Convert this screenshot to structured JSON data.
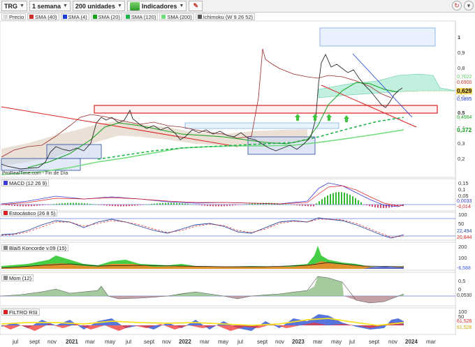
{
  "toolbar": {
    "symbol": "TRG",
    "period": "1 semana",
    "units": "200 unidades",
    "indicators": "Indicadores",
    "icon_refresh": "refresh-icon",
    "icon_settings": "settings-icon"
  },
  "legend": [
    {
      "label": "Precio",
      "color": "#d9d9d9"
    },
    {
      "label": "SMA (40)",
      "color": "#d12d2d"
    },
    {
      "label": "SMA (4)",
      "color": "#1b3bd6"
    },
    {
      "label": "SMA (20)",
      "color": "#15a11e"
    },
    {
      "label": "SMA (120)",
      "color": "#1db44b"
    },
    {
      "label": "SMA (200)",
      "color": "#6ddc7a"
    },
    {
      "label": "Ichimoku (W 9 26 52)",
      "color": "#555555"
    }
  ],
  "watermark": "ProRealTime.com - Fin de Día",
  "price_axis": [
    "1",
    "0,9",
    "0,8",
    "0,7",
    "0,6",
    "0,5",
    "0,4",
    "0,3",
    "0,2"
  ],
  "price_tags": [
    {
      "text": "0,7022",
      "bg": "#ffffff",
      "fg": "#5ec85e"
    },
    {
      "text": "0,6900",
      "bg": "#ffffff",
      "fg": "#c0392b"
    },
    {
      "text": "0,629",
      "bg": "#f6d65a",
      "fg": "#111111"
    },
    {
      "text": "0,5895",
      "bg": "#ffffff",
      "fg": "#1b3bd6"
    },
    {
      "text": "0,4564",
      "bg": "#ffffff",
      "fg": "#15a11e"
    },
    {
      "text": "0,372",
      "bg": "#ffffff",
      "fg": "#15a11e"
    }
  ],
  "panels": {
    "macd": {
      "label": "MACD (12 26 9)",
      "axis": [
        "0,15",
        "0,1",
        "0,05"
      ],
      "tags": [
        "0,0033",
        "-0,014"
      ]
    },
    "stoch": {
      "label": "Estocástico (26 8 5)",
      "axis": [
        "100",
        "50"
      ],
      "tags": [
        "22,494",
        "20,844"
      ]
    },
    "blai": {
      "label": "Blai5 Koncorde v.09 (15)",
      "axis": [
        "200",
        "100"
      ],
      "tags": [
        "-6,588"
      ]
    },
    "mom": {
      "label": "Mom (12)",
      "axis": [
        "0,5",
        "0"
      ],
      "tags": [
        "0,0530"
      ]
    },
    "rsi": {
      "label": "FILTRO RSI",
      "axis": [
        "100",
        "50"
      ],
      "tags": [
        "61,526",
        "61,526"
      ]
    }
  },
  "x_axis": [
    {
      "text": "jul",
      "bold": false
    },
    {
      "text": "sept",
      "bold": false
    },
    {
      "text": "nov",
      "bold": false
    },
    {
      "text": "2021",
      "bold": true
    },
    {
      "text": "mar",
      "bold": false
    },
    {
      "text": "may",
      "bold": false
    },
    {
      "text": "jul",
      "bold": false
    },
    {
      "text": "sept",
      "bold": false
    },
    {
      "text": "nov",
      "bold": false
    },
    {
      "text": "2022",
      "bold": true
    },
    {
      "text": "mar",
      "bold": false
    },
    {
      "text": "may",
      "bold": false
    },
    {
      "text": "jul",
      "bold": false
    },
    {
      "text": "sept",
      "bold": false
    },
    {
      "text": "nov",
      "bold": false
    },
    {
      "text": "2023",
      "bold": true
    },
    {
      "text": "mar",
      "bold": false
    },
    {
      "text": "may",
      "bold": false
    },
    {
      "text": "jul",
      "bold": false
    },
    {
      "text": "sept",
      "bold": false
    },
    {
      "text": "nov",
      "bold": false
    },
    {
      "text": "2024",
      "bold": true
    },
    {
      "text": "mar",
      "bold": false
    }
  ]
}
